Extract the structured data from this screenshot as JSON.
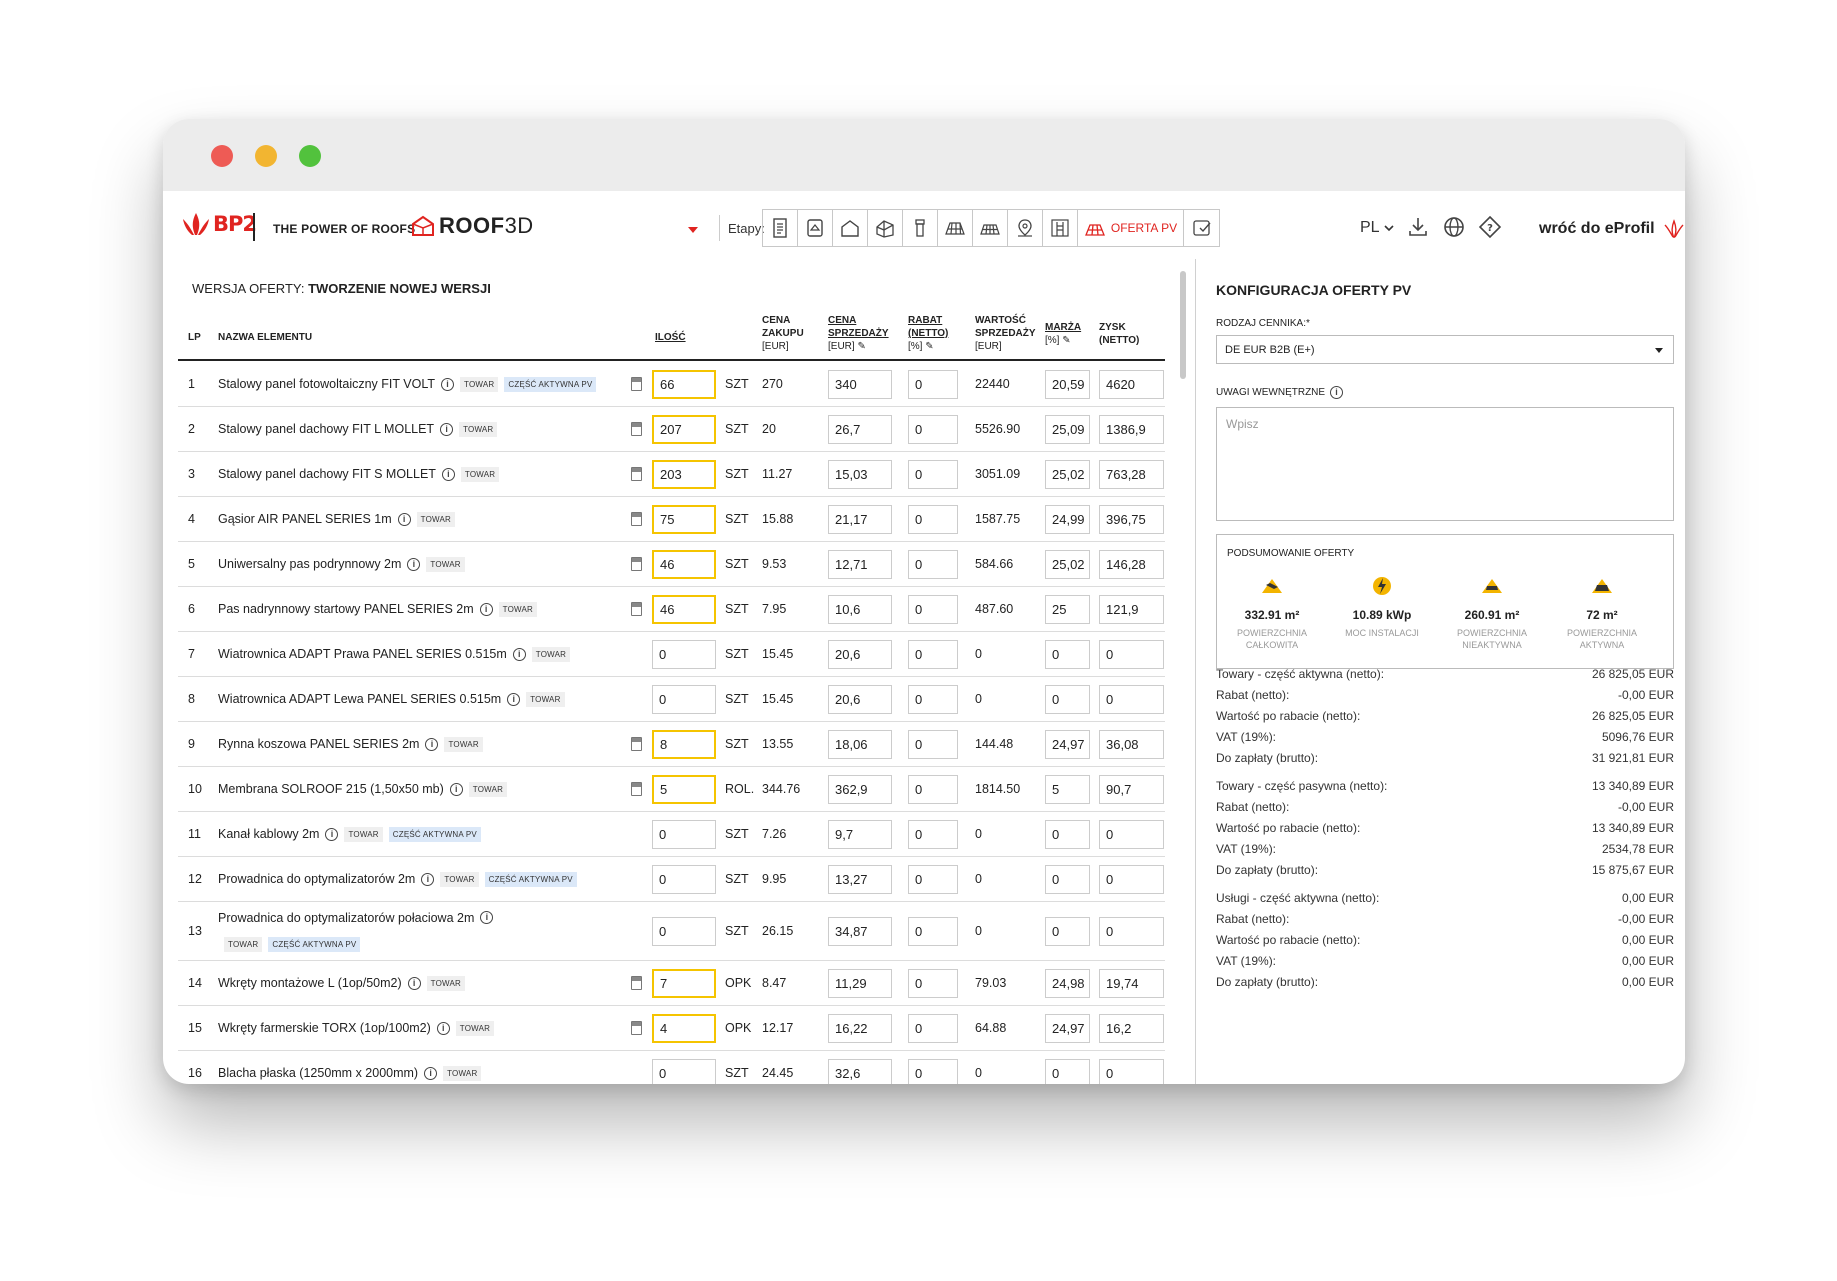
{
  "header": {
    "brand": "BP2",
    "slogan": "THE POWER OF ROOFS",
    "product_bold": "ROOF",
    "product_thin": "3D",
    "etapy_label": "Etapy:",
    "active_stage": "OFERTA PV",
    "lang": "PL",
    "back_link": "wróć do eProfil",
    "stage_icons": [
      "document-icon",
      "roof-photo-icon",
      "house-outline-icon",
      "house-3d-icon",
      "chimney-icon",
      "roof-panels-icon",
      "pv-panels-icon",
      "location-pin-icon",
      "ladder-icon",
      "pv-offer-icon",
      "checklist-icon"
    ]
  },
  "version": {
    "label": "WERSJA OFERTY:",
    "value": "TWORZENIE NOWEJ WERSJI"
  },
  "table": {
    "headers": {
      "lp": "LP",
      "name": "NAZWA ELEMENTU",
      "qty": "ILOŚĆ",
      "buy_1": "CENA",
      "buy_2": "ZAKUPU",
      "buy_3": "[EUR]",
      "sell_1": "CENA",
      "sell_2": "SPRZEDAŻY",
      "sell_3": "[EUR] ✎",
      "rab_1": "RABAT",
      "rab_2": "(NETTO)",
      "rab_3": "[%] ✎",
      "val_1": "WARTOŚĆ",
      "val_2": "SPRZEDAŻY",
      "val_3": "[EUR]",
      "mar_1": "MARŻA",
      "mar_2": "[%] ✎",
      "zys_1": "ZYSK",
      "zys_2": "(NETTO)"
    },
    "rows": [
      {
        "lp": "1",
        "name": "Stalowy panel fotowoltaiczny FIT VOLT",
        "tags": [
          "TOWAR",
          "CZĘŚĆ AKTYWNA PV"
        ],
        "calc": true,
        "qty": "66",
        "qty_hl": true,
        "unit": "SZT",
        "buy": "270",
        "sell": "340",
        "rab": "0",
        "val": "22440",
        "mar": "20,59",
        "zys": "4620"
      },
      {
        "lp": "2",
        "name": "Stalowy panel dachowy FIT L MOLLET",
        "tags": [
          "TOWAR"
        ],
        "calc": true,
        "qty": "207",
        "qty_hl": true,
        "unit": "SZT",
        "buy": "20",
        "sell": "26,7",
        "rab": "0",
        "val": "5526.90",
        "mar": "25,09",
        "zys": "1386,9"
      },
      {
        "lp": "3",
        "name": "Stalowy panel dachowy FIT S MOLLET",
        "tags": [
          "TOWAR"
        ],
        "calc": true,
        "qty": "203",
        "qty_hl": true,
        "unit": "SZT",
        "buy": "11.27",
        "sell": "15,03",
        "rab": "0",
        "val": "3051.09",
        "mar": "25,02",
        "zys": "763,28"
      },
      {
        "lp": "4",
        "name": "Gąsior AIR PANEL SERIES 1m",
        "tags": [
          "TOWAR"
        ],
        "calc": true,
        "qty": "75",
        "qty_hl": true,
        "unit": "SZT",
        "buy": "15.88",
        "sell": "21,17",
        "rab": "0",
        "val": "1587.75",
        "mar": "24,99",
        "zys": "396,75"
      },
      {
        "lp": "5",
        "name": "Uniwersalny pas podrynnowy 2m",
        "tags": [
          "TOWAR"
        ],
        "calc": true,
        "qty": "46",
        "qty_hl": true,
        "unit": "SZT",
        "buy": "9.53",
        "sell": "12,71",
        "rab": "0",
        "val": "584.66",
        "mar": "25,02",
        "zys": "146,28"
      },
      {
        "lp": "6",
        "name": "Pas nadrynnowy startowy PANEL SERIES 2m",
        "tags": [
          "TOWAR"
        ],
        "calc": true,
        "qty": "46",
        "qty_hl": true,
        "unit": "SZT",
        "buy": "7.95",
        "sell": "10,6",
        "rab": "0",
        "val": "487.60",
        "mar": "25",
        "zys": "121,9"
      },
      {
        "lp": "7",
        "name": "Wiatrownica ADAPT Prawa PANEL SERIES 0.515m",
        "tags": [
          "TOWAR"
        ],
        "calc": false,
        "qty": "0",
        "qty_hl": false,
        "unit": "SZT",
        "buy": "15.45",
        "sell": "20,6",
        "rab": "0",
        "val": "0",
        "mar": "0",
        "zys": "0"
      },
      {
        "lp": "8",
        "name": "Wiatrownica ADAPT Lewa PANEL SERIES 0.515m",
        "tags": [
          "TOWAR"
        ],
        "calc": false,
        "qty": "0",
        "qty_hl": false,
        "unit": "SZT",
        "buy": "15.45",
        "sell": "20,6",
        "rab": "0",
        "val": "0",
        "mar": "0",
        "zys": "0"
      },
      {
        "lp": "9",
        "name": "Rynna koszowa PANEL SERIES 2m",
        "tags": [
          "TOWAR"
        ],
        "calc": true,
        "qty": "8",
        "qty_hl": true,
        "unit": "SZT",
        "buy": "13.55",
        "sell": "18,06",
        "rab": "0",
        "val": "144.48",
        "mar": "24,97",
        "zys": "36,08"
      },
      {
        "lp": "10",
        "name": "Membrana SOLROOF 215 (1,50x50 mb)",
        "tags": [
          "TOWAR"
        ],
        "calc": true,
        "qty": "5",
        "qty_hl": true,
        "unit": "ROL.",
        "buy": "344.76",
        "sell": "362,9",
        "rab": "0",
        "val": "1814.50",
        "mar": "5",
        "zys": "90,7"
      },
      {
        "lp": "11",
        "name": "Kanał kablowy 2m",
        "tags": [
          "TOWAR",
          "CZĘŚĆ AKTYWNA PV"
        ],
        "calc": false,
        "qty": "0",
        "qty_hl": false,
        "unit": "SZT",
        "buy": "7.26",
        "sell": "9,7",
        "rab": "0",
        "val": "0",
        "mar": "0",
        "zys": "0"
      },
      {
        "lp": "12",
        "name": "Prowadnica do optymalizatorów 2m",
        "tags": [
          "TOWAR",
          "CZĘŚĆ AKTYWNA PV"
        ],
        "calc": false,
        "qty": "0",
        "qty_hl": false,
        "unit": "SZT",
        "buy": "9.95",
        "sell": "13,27",
        "rab": "0",
        "val": "0",
        "mar": "0",
        "zys": "0"
      },
      {
        "lp": "13",
        "name": "Prowadnica do optymalizatorów połaciowa 2m",
        "tags": [
          "TOWAR",
          "CZĘŚĆ AKTYWNA PV"
        ],
        "calc": false,
        "qty": "0",
        "qty_hl": false,
        "unit": "SZT",
        "buy": "26.15",
        "sell": "34,87",
        "rab": "0",
        "val": "0",
        "mar": "0",
        "zys": "0",
        "tall": true
      },
      {
        "lp": "14",
        "name": "Wkręty montażowe L (1op/50m2)",
        "tags": [
          "TOWAR"
        ],
        "calc": true,
        "qty": "7",
        "qty_hl": true,
        "unit": "OPK",
        "buy": "8.47",
        "sell": "11,29",
        "rab": "0",
        "val": "79.03",
        "mar": "24,98",
        "zys": "19,74"
      },
      {
        "lp": "15",
        "name": "Wkręty farmerskie TORX (1op/100m2)",
        "tags": [
          "TOWAR"
        ],
        "calc": true,
        "qty": "4",
        "qty_hl": true,
        "unit": "OPK",
        "buy": "12.17",
        "sell": "16,22",
        "rab": "0",
        "val": "64.88",
        "mar": "24,97",
        "zys": "16,2"
      },
      {
        "lp": "16",
        "name": "Blacha płaska (1250mm x 2000mm)",
        "tags": [
          "TOWAR"
        ],
        "calc": false,
        "qty": "0",
        "qty_hl": false,
        "unit": "SZT",
        "buy": "24.45",
        "sell": "32,6",
        "rab": "0",
        "val": "0",
        "mar": "0",
        "zys": "0"
      }
    ]
  },
  "right": {
    "title": "KONFIGURACJA OFERTY PV",
    "pricelist_label": "RODZAJ CENNIKA:*",
    "pricelist_value": "DE EUR B2B (E+)",
    "notes_label": "UWAGI WEWNĘTRZNE",
    "notes_placeholder": "Wpisz",
    "summary_title": "PODSUMOWANIE OFERTY",
    "stats": [
      {
        "value": "332.91 m²",
        "l1": "POWIERZCHNIA",
        "l2": "CAŁKOWITA"
      },
      {
        "value": "10.89 kWp",
        "l1": "MOC INSTALACJI",
        "l2": ""
      },
      {
        "value": "260.91 m²",
        "l1": "POWIERZCHNIA",
        "l2": "NIEAKTYWNA"
      },
      {
        "value": "72 m²",
        "l1": "POWIERZCHNIA",
        "l2": "AKTYWNA"
      }
    ],
    "fin_groups": [
      [
        {
          "label": "Towary - część aktywna (netto):",
          "value": "26 825,05 EUR"
        },
        {
          "label": "Rabat (netto):",
          "value": "-0,00 EUR"
        },
        {
          "label": "Wartość po rabacie (netto):",
          "value": "26 825,05 EUR"
        },
        {
          "label": "VAT (19%):",
          "value": "5096,76 EUR"
        },
        {
          "label": "Do zapłaty (brutto):",
          "value": "31 921,81 EUR"
        }
      ],
      [
        {
          "label": "Towary - część pasywna (netto):",
          "value": "13 340,89 EUR"
        },
        {
          "label": "Rabat (netto):",
          "value": "-0,00 EUR"
        },
        {
          "label": "Wartość po rabacie (netto):",
          "value": "13 340,89 EUR"
        },
        {
          "label": "VAT (19%):",
          "value": "2534,78 EUR"
        },
        {
          "label": "Do zapłaty (brutto):",
          "value": "15 875,67 EUR"
        }
      ],
      [
        {
          "label": "Usługi - część aktywna (netto):",
          "value": "0,00 EUR"
        },
        {
          "label": "Rabat (netto):",
          "value": "-0,00 EUR"
        },
        {
          "label": "Wartość po rabacie (netto):",
          "value": "0,00 EUR"
        },
        {
          "label": "VAT (19%):",
          "value": "0,00 EUR"
        },
        {
          "label": "Do zapłaty (brutto):",
          "value": "0,00 EUR"
        }
      ]
    ]
  },
  "colors": {
    "brand_red": "#e02420",
    "highlight_yellow": "#f5c400",
    "pv_tag": "#dbe8f8"
  }
}
